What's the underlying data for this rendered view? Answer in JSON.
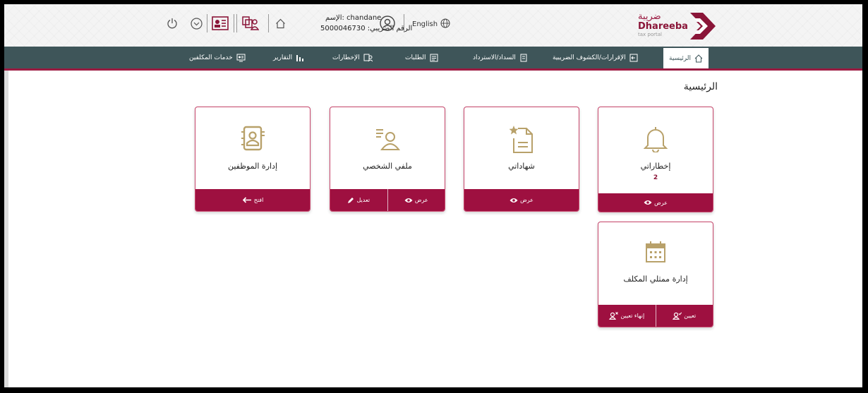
{
  "header": {
    "language": "English",
    "user_name": "الإسم: chandane",
    "tax_number": "الرقم الضريبي: 5000046730",
    "logo": {
      "arabic": "ضريبة",
      "english": "Dhareeba",
      "tagline": "tax portal"
    }
  },
  "nav": {
    "items": [
      {
        "label": "الرئيسية",
        "icon": "home-icon"
      },
      {
        "label": "الإقرارات/الكشوف الضريبية",
        "icon": "returns-icon"
      },
      {
        "label": "السداد/الاسترداد",
        "icon": "payment-icon"
      },
      {
        "label": "الطلبات",
        "icon": "requests-icon"
      },
      {
        "label": "الإخطارات",
        "icon": "notifications-icon"
      },
      {
        "label": "التقارير",
        "icon": "reports-icon"
      },
      {
        "label": "خدمات المكلفين",
        "icon": "taxpayer-services-icon"
      }
    ]
  },
  "page": {
    "title": "الرئيسية"
  },
  "cards": {
    "notifications": {
      "title": "إخطاراتي",
      "count": "2",
      "view": "عرض"
    },
    "certificates": {
      "title": "شهاداتي",
      "view": "عرض"
    },
    "profile": {
      "title": "ملفي الشخصي",
      "view": "عرض",
      "edit": "تعديل"
    },
    "employees": {
      "title": "إدارة الموظفين",
      "open": "افتح"
    },
    "representatives": {
      "title": "إدارة ممثلي المكلف",
      "assign": "تعيين",
      "end_assign": "إنهاء تعيين"
    }
  },
  "colors": {
    "primary": "#9e1040",
    "nav": "#3e5559",
    "icon_gold": "#b8a16a"
  }
}
